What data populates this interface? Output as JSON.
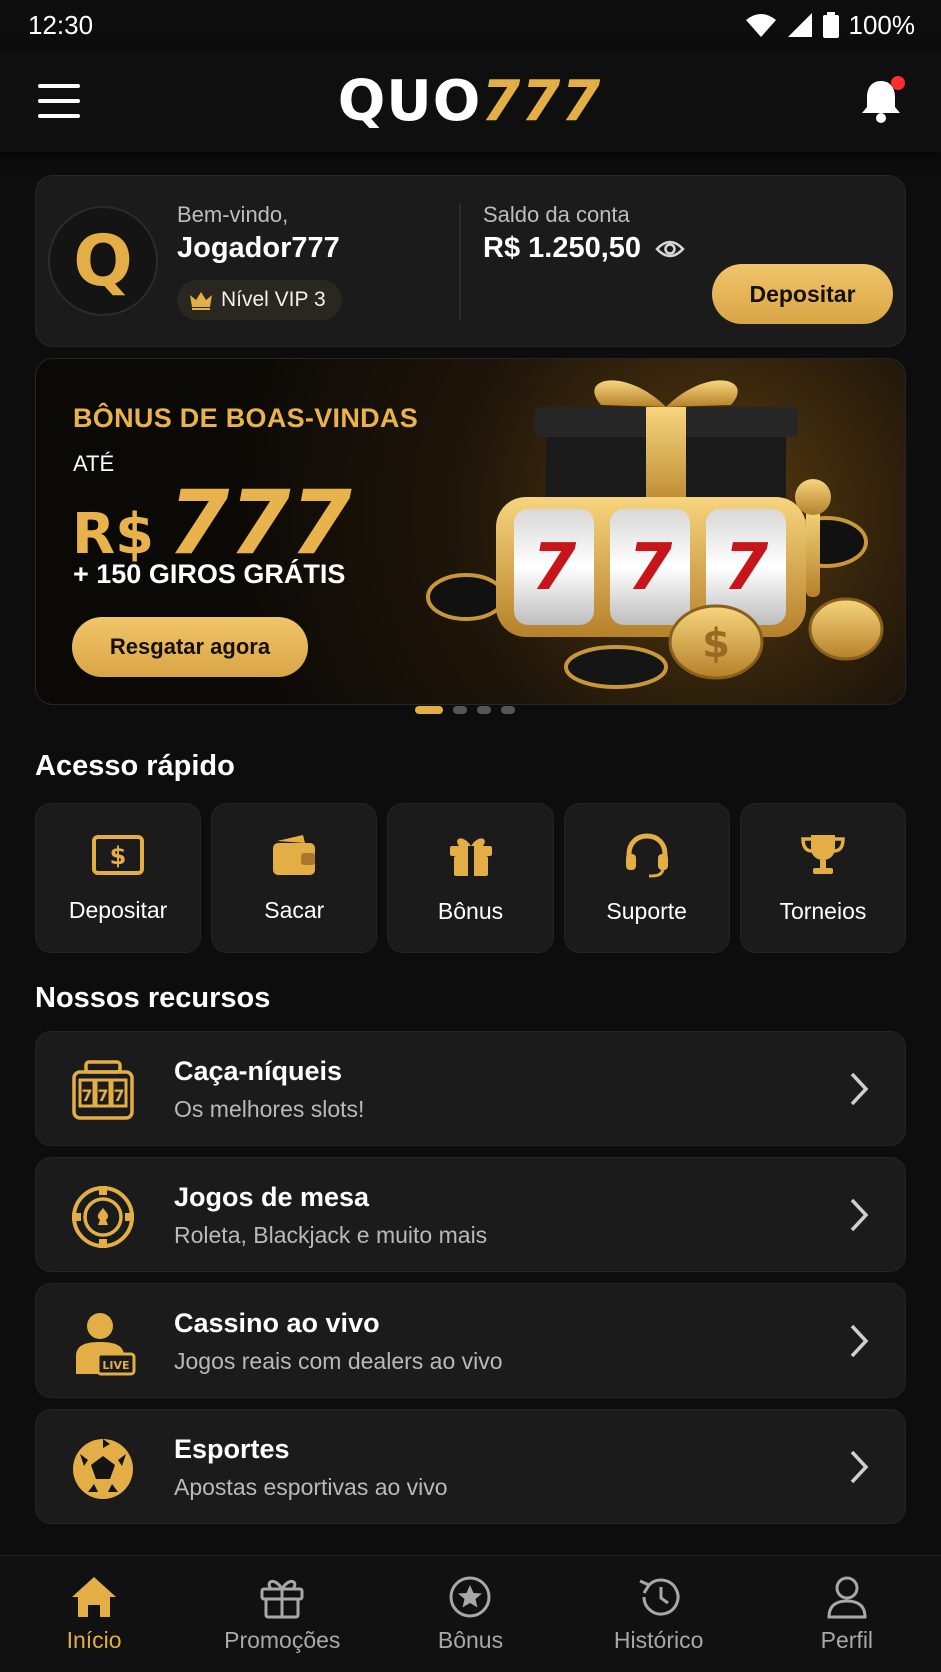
{
  "status_bar": {
    "time": "12:30",
    "battery": "100%"
  },
  "header": {
    "logo_part1": "QUO",
    "logo_part2": "777"
  },
  "welcome_card": {
    "avatar_letter": "Q",
    "greeting": "Bem-vindo,",
    "username": "Jogador777",
    "vip_level": "Nível VIP 3",
    "balance_label": "Saldo da conta",
    "balance_value": "R$ 1.250,50",
    "deposit_label": "Depositar"
  },
  "banner": {
    "title": "BÔNUS DE BOAS-VINDAS",
    "upto": "ATÉ",
    "currency": "R$",
    "amount": "777",
    "spins": "+ 150 GIROS GRÁTIS",
    "button": "Resgatar agora",
    "slide_count": 4,
    "active_slide": 1
  },
  "quick_access": {
    "title": "Acesso rápido",
    "items": [
      {
        "label": "Depositar",
        "icon": "cash-icon"
      },
      {
        "label": "Sacar",
        "icon": "wallet-icon"
      },
      {
        "label": "Bônus",
        "icon": "gift-icon"
      },
      {
        "label": "Suporte",
        "icon": "headset-icon"
      },
      {
        "label": "Torneios",
        "icon": "trophy-icon"
      }
    ]
  },
  "features": {
    "title": "Nossos recursos",
    "items": [
      {
        "title": "Caça-níqueis",
        "subtitle": "Os melhores slots!",
        "icon": "slot-machine-icon"
      },
      {
        "title": "Jogos de mesa",
        "subtitle": "Roleta, Blackjack e muito mais",
        "icon": "poker-chip-icon"
      },
      {
        "title": "Cassino ao vivo",
        "subtitle": "Jogos reais com dealers ao vivo",
        "icon": "live-dealer-icon"
      },
      {
        "title": "Esportes",
        "subtitle": "Apostas esportivas ao vivo",
        "icon": "soccer-ball-icon"
      }
    ]
  },
  "bottom_nav": {
    "items": [
      {
        "label": "Início",
        "icon": "home-icon",
        "active": true
      },
      {
        "label": "Promoções",
        "icon": "gift-icon",
        "active": false
      },
      {
        "label": "Bônus",
        "icon": "star-badge-icon",
        "active": false
      },
      {
        "label": "Histórico",
        "icon": "history-icon",
        "active": false
      },
      {
        "label": "Perfil",
        "icon": "user-icon",
        "active": false
      }
    ]
  },
  "colors": {
    "accent": "#e2ae45",
    "background": "#0d0d0d",
    "card": "#1b1b1b",
    "notification": "#ff2d2d"
  }
}
